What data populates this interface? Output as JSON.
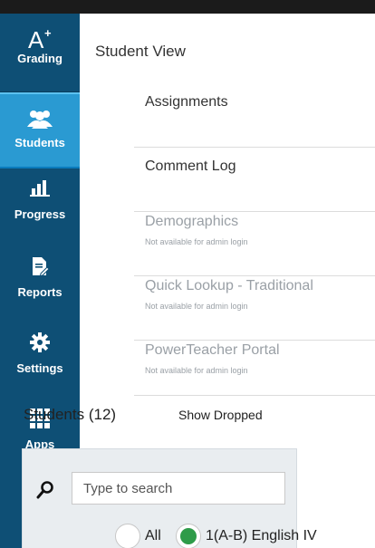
{
  "sidebar": {
    "items": [
      {
        "label": "Grading",
        "icon": "grading-icon",
        "active": false
      },
      {
        "label": "Students",
        "icon": "students-icon",
        "active": true
      },
      {
        "label": "Progress",
        "icon": "progress-chart-icon",
        "active": false
      },
      {
        "label": "Reports",
        "icon": "report-edit-icon",
        "active": false
      },
      {
        "label": "Settings",
        "icon": "gear-icon",
        "active": false
      },
      {
        "label": "Apps",
        "icon": "apps-grid-icon",
        "active": false
      }
    ],
    "background_color": "#0e4f75",
    "active_color": "#2a9ad2"
  },
  "main": {
    "title": "Student View",
    "menu": [
      {
        "label": "Assignments",
        "sub": null
      },
      {
        "label": "Comment Log",
        "sub": null
      },
      {
        "label": "Demographics",
        "sub": "Not available for admin login"
      },
      {
        "label": "Quick Lookup - Traditional",
        "sub": "Not available for admin login"
      },
      {
        "label": "PowerTeacher Portal",
        "sub": "Not available for admin login"
      }
    ]
  },
  "students": {
    "title": "Students (12)",
    "show_dropped": "Show Dropped",
    "search_placeholder": "Type to search",
    "filters": [
      {
        "label": "All",
        "selected": false
      },
      {
        "label": "1(A-B) English IV",
        "selected": true
      }
    ]
  }
}
